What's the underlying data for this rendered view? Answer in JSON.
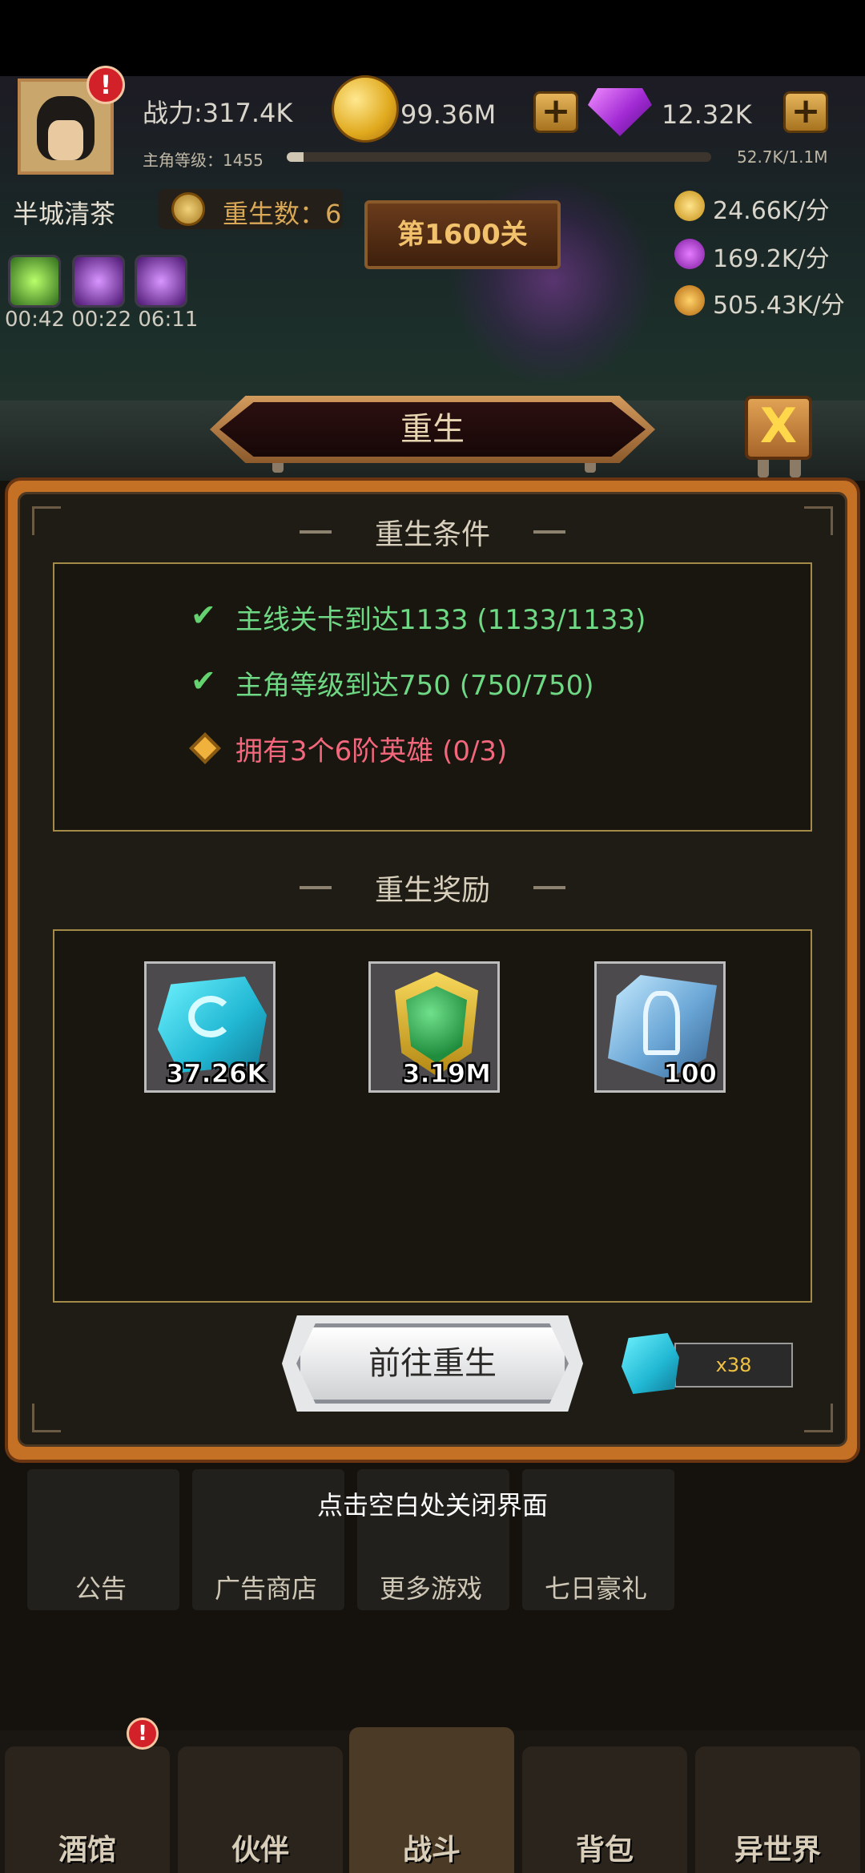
{
  "hud": {
    "power_label": "战力:317.4K",
    "level_label": "主角等级：1455",
    "xp_text": "52.7K/1.1M",
    "xp_fraction": 0.04,
    "coins": "99.36M",
    "gems": "12.32K",
    "player_name": "半城清茶",
    "rebirth_count": "重生数：6",
    "stage": "第1600关",
    "rates": [
      "24.66K/分",
      "169.2K/分",
      "505.43K/分"
    ],
    "timer": "00:42 00:22 06:11",
    "alert_mark": "!"
  },
  "popup": {
    "title": "重生",
    "close_symbol": "X",
    "conditions_title": "重生条件",
    "conditions": [
      {
        "text": "主线关卡到达1133 (1133/1133)",
        "status": "done",
        "color": "#6fd884"
      },
      {
        "text": "主角等级到达750 (750/750)",
        "status": "done",
        "color": "#6fd884"
      },
      {
        "text": "拥有3个6阶英雄 (0/3)",
        "status": "pending",
        "color": "#f2677b"
      }
    ],
    "rewards_title": "重生奖励",
    "rewards": [
      {
        "icon": "rune-stone-icon",
        "qty": "37.26K"
      },
      {
        "icon": "green-shield-icon",
        "qty": "3.19M"
      },
      {
        "icon": "axe-stone-icon",
        "qty": "100"
      }
    ],
    "go_button": "前往重生",
    "cost": "x38"
  },
  "hint": "点击空白处关闭界面",
  "menu": [
    "公告",
    "广告商店",
    "更多游戏",
    "七日豪礼"
  ],
  "tabs": [
    "酒馆",
    "伙伴",
    "战斗",
    "背包",
    "异世界"
  ]
}
